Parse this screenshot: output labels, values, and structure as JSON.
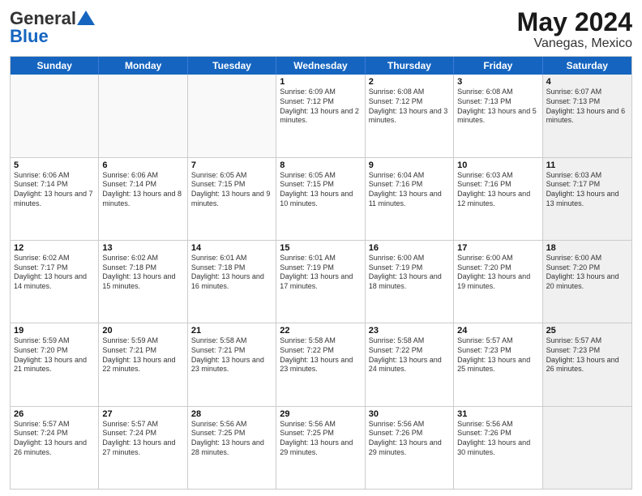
{
  "header": {
    "logo_general": "General",
    "logo_blue": "Blue",
    "title": "May 2024",
    "subtitle": "Vanegas, Mexico"
  },
  "days_of_week": [
    "Sunday",
    "Monday",
    "Tuesday",
    "Wednesday",
    "Thursday",
    "Friday",
    "Saturday"
  ],
  "rows": [
    [
      {
        "day": "",
        "empty": true
      },
      {
        "day": "",
        "empty": true
      },
      {
        "day": "",
        "empty": true
      },
      {
        "day": "1",
        "sunrise": "Sunrise: 6:09 AM",
        "sunset": "Sunset: 7:12 PM",
        "daylight": "Daylight: 13 hours and 2 minutes."
      },
      {
        "day": "2",
        "sunrise": "Sunrise: 6:08 AM",
        "sunset": "Sunset: 7:12 PM",
        "daylight": "Daylight: 13 hours and 3 minutes."
      },
      {
        "day": "3",
        "sunrise": "Sunrise: 6:08 AM",
        "sunset": "Sunset: 7:13 PM",
        "daylight": "Daylight: 13 hours and 5 minutes."
      },
      {
        "day": "4",
        "sunrise": "Sunrise: 6:07 AM",
        "sunset": "Sunset: 7:13 PM",
        "daylight": "Daylight: 13 hours and 6 minutes.",
        "shaded": true
      }
    ],
    [
      {
        "day": "5",
        "sunrise": "Sunrise: 6:06 AM",
        "sunset": "Sunset: 7:14 PM",
        "daylight": "Daylight: 13 hours and 7 minutes."
      },
      {
        "day": "6",
        "sunrise": "Sunrise: 6:06 AM",
        "sunset": "Sunset: 7:14 PM",
        "daylight": "Daylight: 13 hours and 8 minutes."
      },
      {
        "day": "7",
        "sunrise": "Sunrise: 6:05 AM",
        "sunset": "Sunset: 7:15 PM",
        "daylight": "Daylight: 13 hours and 9 minutes."
      },
      {
        "day": "8",
        "sunrise": "Sunrise: 6:05 AM",
        "sunset": "Sunset: 7:15 PM",
        "daylight": "Daylight: 13 hours and 10 minutes."
      },
      {
        "day": "9",
        "sunrise": "Sunrise: 6:04 AM",
        "sunset": "Sunset: 7:16 PM",
        "daylight": "Daylight: 13 hours and 11 minutes."
      },
      {
        "day": "10",
        "sunrise": "Sunrise: 6:03 AM",
        "sunset": "Sunset: 7:16 PM",
        "daylight": "Daylight: 13 hours and 12 minutes."
      },
      {
        "day": "11",
        "sunrise": "Sunrise: 6:03 AM",
        "sunset": "Sunset: 7:17 PM",
        "daylight": "Daylight: 13 hours and 13 minutes.",
        "shaded": true
      }
    ],
    [
      {
        "day": "12",
        "sunrise": "Sunrise: 6:02 AM",
        "sunset": "Sunset: 7:17 PM",
        "daylight": "Daylight: 13 hours and 14 minutes."
      },
      {
        "day": "13",
        "sunrise": "Sunrise: 6:02 AM",
        "sunset": "Sunset: 7:18 PM",
        "daylight": "Daylight: 13 hours and 15 minutes."
      },
      {
        "day": "14",
        "sunrise": "Sunrise: 6:01 AM",
        "sunset": "Sunset: 7:18 PM",
        "daylight": "Daylight: 13 hours and 16 minutes."
      },
      {
        "day": "15",
        "sunrise": "Sunrise: 6:01 AM",
        "sunset": "Sunset: 7:19 PM",
        "daylight": "Daylight: 13 hours and 17 minutes."
      },
      {
        "day": "16",
        "sunrise": "Sunrise: 6:00 AM",
        "sunset": "Sunset: 7:19 PM",
        "daylight": "Daylight: 13 hours and 18 minutes."
      },
      {
        "day": "17",
        "sunrise": "Sunrise: 6:00 AM",
        "sunset": "Sunset: 7:20 PM",
        "daylight": "Daylight: 13 hours and 19 minutes."
      },
      {
        "day": "18",
        "sunrise": "Sunrise: 6:00 AM",
        "sunset": "Sunset: 7:20 PM",
        "daylight": "Daylight: 13 hours and 20 minutes.",
        "shaded": true
      }
    ],
    [
      {
        "day": "19",
        "sunrise": "Sunrise: 5:59 AM",
        "sunset": "Sunset: 7:20 PM",
        "daylight": "Daylight: 13 hours and 21 minutes."
      },
      {
        "day": "20",
        "sunrise": "Sunrise: 5:59 AM",
        "sunset": "Sunset: 7:21 PM",
        "daylight": "Daylight: 13 hours and 22 minutes."
      },
      {
        "day": "21",
        "sunrise": "Sunrise: 5:58 AM",
        "sunset": "Sunset: 7:21 PM",
        "daylight": "Daylight: 13 hours and 23 minutes."
      },
      {
        "day": "22",
        "sunrise": "Sunrise: 5:58 AM",
        "sunset": "Sunset: 7:22 PM",
        "daylight": "Daylight: 13 hours and 23 minutes."
      },
      {
        "day": "23",
        "sunrise": "Sunrise: 5:58 AM",
        "sunset": "Sunset: 7:22 PM",
        "daylight": "Daylight: 13 hours and 24 minutes."
      },
      {
        "day": "24",
        "sunrise": "Sunrise: 5:57 AM",
        "sunset": "Sunset: 7:23 PM",
        "daylight": "Daylight: 13 hours and 25 minutes."
      },
      {
        "day": "25",
        "sunrise": "Sunrise: 5:57 AM",
        "sunset": "Sunset: 7:23 PM",
        "daylight": "Daylight: 13 hours and 26 minutes.",
        "shaded": true
      }
    ],
    [
      {
        "day": "26",
        "sunrise": "Sunrise: 5:57 AM",
        "sunset": "Sunset: 7:24 PM",
        "daylight": "Daylight: 13 hours and 26 minutes."
      },
      {
        "day": "27",
        "sunrise": "Sunrise: 5:57 AM",
        "sunset": "Sunset: 7:24 PM",
        "daylight": "Daylight: 13 hours and 27 minutes."
      },
      {
        "day": "28",
        "sunrise": "Sunrise: 5:56 AM",
        "sunset": "Sunset: 7:25 PM",
        "daylight": "Daylight: 13 hours and 28 minutes."
      },
      {
        "day": "29",
        "sunrise": "Sunrise: 5:56 AM",
        "sunset": "Sunset: 7:25 PM",
        "daylight": "Daylight: 13 hours and 29 minutes."
      },
      {
        "day": "30",
        "sunrise": "Sunrise: 5:56 AM",
        "sunset": "Sunset: 7:26 PM",
        "daylight": "Daylight: 13 hours and 29 minutes."
      },
      {
        "day": "31",
        "sunrise": "Sunrise: 5:56 AM",
        "sunset": "Sunset: 7:26 PM",
        "daylight": "Daylight: 13 hours and 30 minutes."
      },
      {
        "day": "",
        "empty": true,
        "shaded": true
      }
    ]
  ]
}
